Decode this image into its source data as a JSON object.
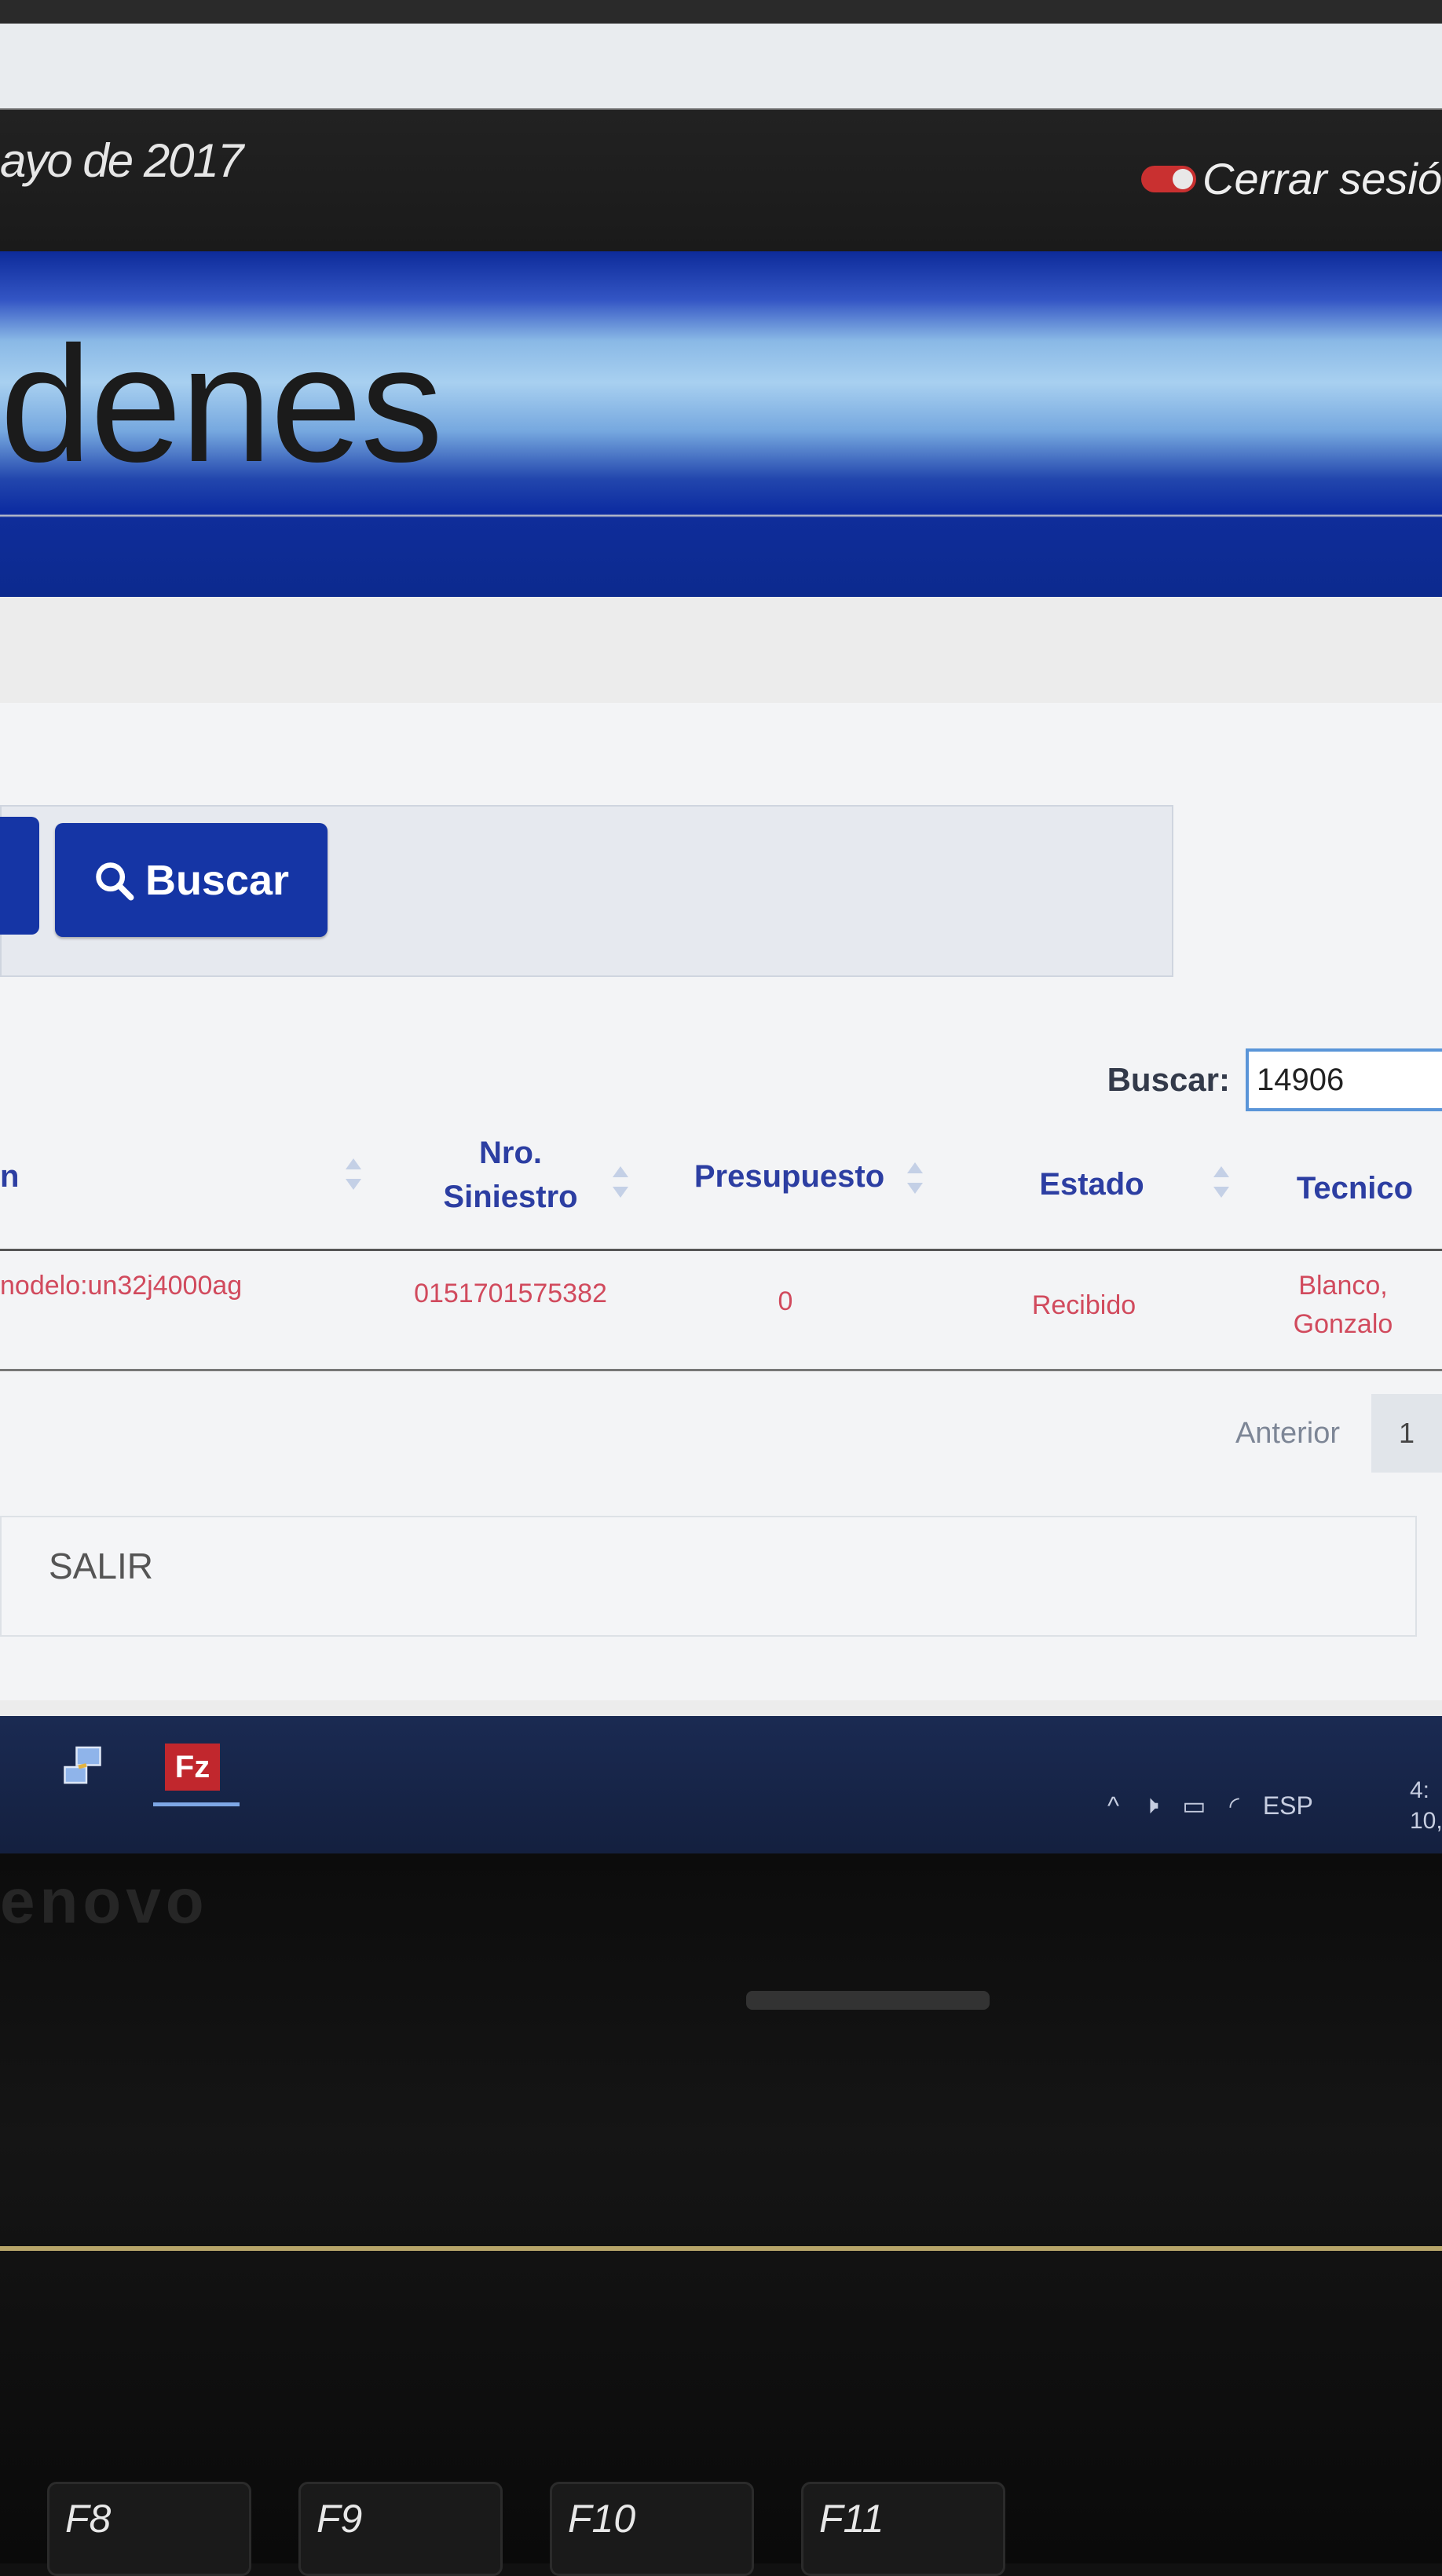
{
  "topbar": {
    "date": "ayo de 2017",
    "logout_label": "Cerrar sesió"
  },
  "banner": {
    "title": "denes"
  },
  "filters": {
    "search_button_label": "Buscar"
  },
  "table_search": {
    "label": "Buscar:",
    "value": "14906"
  },
  "table": {
    "columns": [
      {
        "label": "n"
      },
      {
        "label": "Nro.",
        "label2": "Siniestro"
      },
      {
        "label": "Presupuesto"
      },
      {
        "label": "Estado"
      },
      {
        "label": "Tecnico"
      }
    ],
    "rows": [
      {
        "col0": "nodelo:un32j4000ag",
        "siniestro": "0151701575382",
        "presupuesto": "0",
        "estado": "Recibido",
        "tecnico1": "Blanco,",
        "tecnico2": "Gonzalo"
      }
    ]
  },
  "pagination": {
    "prev_label": "Anterior",
    "page_1": "1"
  },
  "footer": {
    "salir_label": "SALIR"
  },
  "taskbar": {
    "language": "ESP",
    "clock1": "4:",
    "clock2": "10,"
  },
  "laptop": {
    "brand": "enovo",
    "keys": [
      "F8",
      "F9",
      "F10",
      "F11"
    ]
  }
}
